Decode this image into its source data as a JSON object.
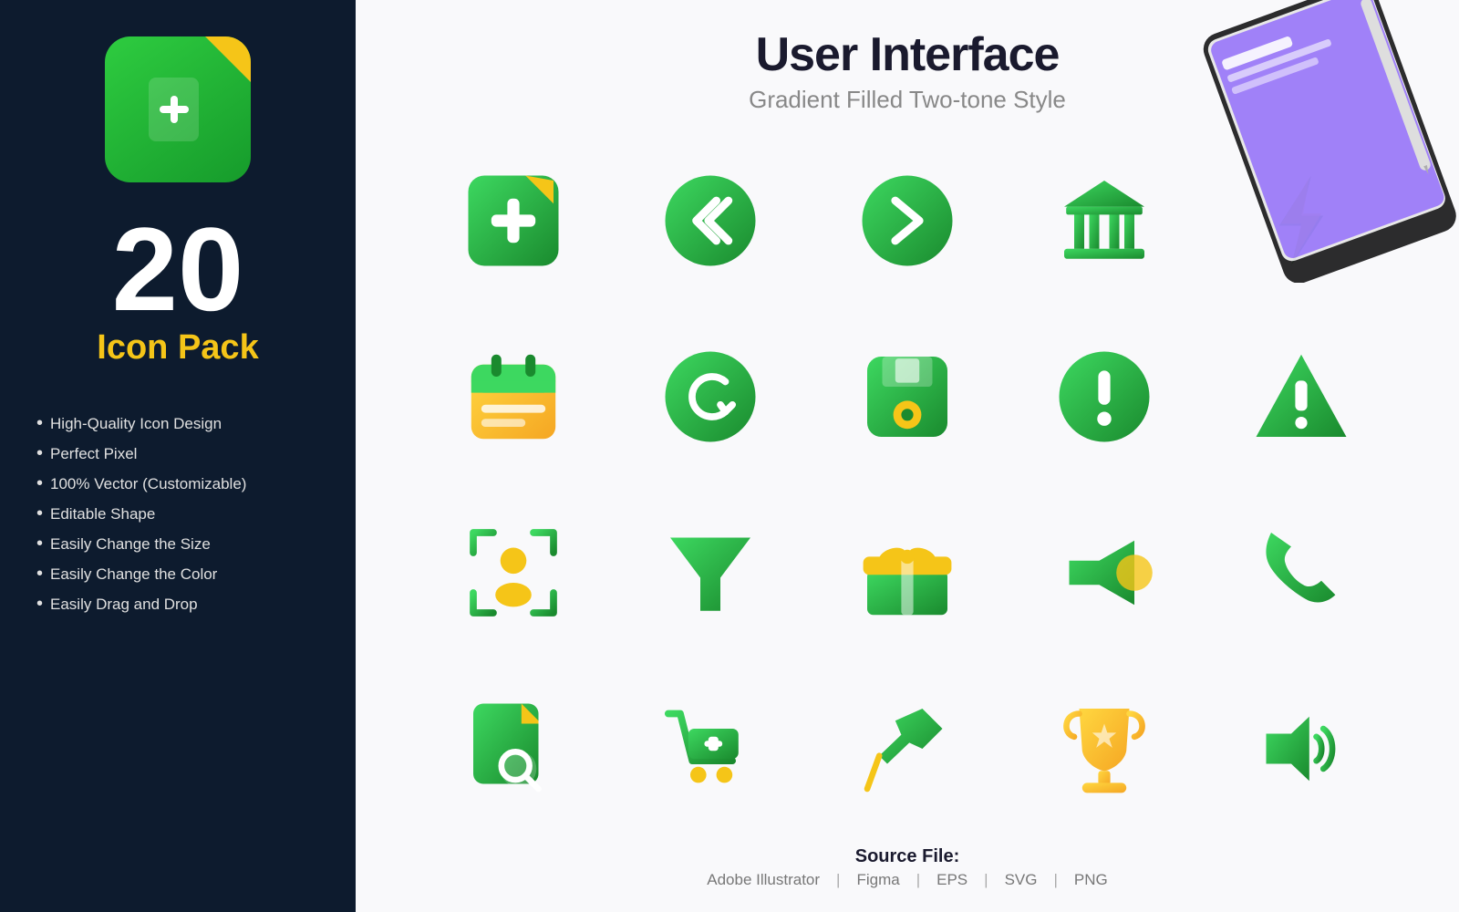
{
  "left": {
    "big_number": "20",
    "icon_pack_label": "Icon Pack",
    "features": [
      "High-Quality Icon Design",
      "Perfect Pixel",
      "100% Vector (Customizable)",
      "Editable Shape",
      "Easily Change the Size",
      "Easily Change the Color",
      "Easily Drag and Drop"
    ]
  },
  "right": {
    "title": "User Interface",
    "subtitle": "Gradient Filled Two-tone Style",
    "source_file_title": "Source File:",
    "source_formats": [
      "Adobe Illustrator",
      "Figma",
      "EPS",
      "SVG",
      "PNG"
    ]
  },
  "colors": {
    "green_dark": "#1a8a2e",
    "green_light": "#2ecc40",
    "yellow": "#f5c518",
    "navy": "#0d1b2e",
    "white": "#ffffff"
  }
}
